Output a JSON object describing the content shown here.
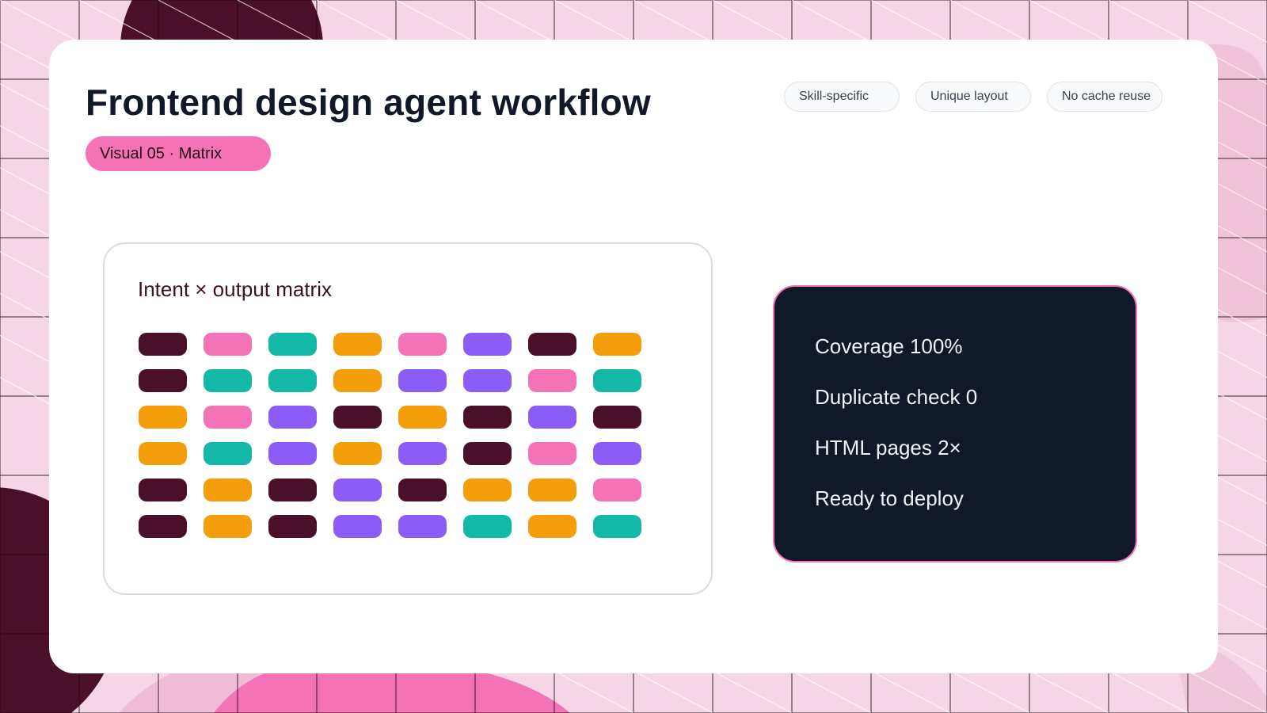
{
  "header": {
    "title": "Frontend design agent workflow",
    "subtitle": "Visual 05 · Matrix",
    "tags": [
      "Skill-specific",
      "Unique layout",
      "No cache reuse"
    ]
  },
  "matrix": {
    "title": "Intent × output matrix",
    "palette": {
      "plum": "#4a1029",
      "pink": "#f472b6",
      "teal": "#14b8a6",
      "orange": "#f59e0b",
      "purple": "#8b5cf6"
    },
    "rows": [
      [
        "plum",
        "pink",
        "teal",
        "orange",
        "pink",
        "purple",
        "plum",
        "orange"
      ],
      [
        "plum",
        "teal",
        "teal",
        "orange",
        "purple",
        "purple",
        "pink",
        "teal"
      ],
      [
        "orange",
        "pink",
        "purple",
        "plum",
        "orange",
        "plum",
        "purple",
        "plum"
      ],
      [
        "orange",
        "teal",
        "purple",
        "orange",
        "purple",
        "plum",
        "pink",
        "purple"
      ],
      [
        "plum",
        "orange",
        "plum",
        "purple",
        "plum",
        "orange",
        "orange",
        "pink"
      ],
      [
        "plum",
        "orange",
        "plum",
        "purple",
        "purple",
        "teal",
        "orange",
        "teal"
      ]
    ]
  },
  "stats": {
    "items": [
      "Coverage 100%",
      "Duplicate check 0",
      "HTML pages 2×",
      "Ready to deploy"
    ]
  },
  "colors": {
    "accent": "#f472b6",
    "dark_panel": "#111827",
    "background_plum": "#4a1029",
    "background_pink": "#f472b6",
    "background_light": "#fbe7f1"
  }
}
